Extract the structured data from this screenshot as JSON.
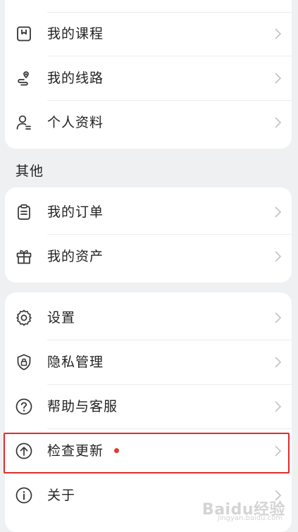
{
  "cards": [
    {
      "items": [
        {
          "label": "我的课程",
          "icon": "bookmark-icon"
        },
        {
          "label": "我的线路",
          "icon": "route-icon"
        },
        {
          "label": "个人资料",
          "icon": "profile-icon"
        }
      ]
    },
    {
      "items": [
        {
          "label": "我的订单",
          "icon": "clipboard-icon"
        },
        {
          "label": "我的资产",
          "icon": "gift-icon"
        }
      ]
    },
    {
      "items": [
        {
          "label": "设置",
          "icon": "gear-icon"
        },
        {
          "label": "隐私管理",
          "icon": "shield-lock-icon"
        },
        {
          "label": "帮助与客服",
          "icon": "help-icon"
        },
        {
          "label": "检查更新",
          "icon": "upload-arrow-icon",
          "badge": "red-dot"
        },
        {
          "label": "关于",
          "icon": "info-icon"
        }
      ]
    }
  ],
  "section_title_other": "其他",
  "highlight_item": "检查更新",
  "colors": {
    "background": "#eff0f2",
    "card": "#ffffff",
    "highlight": "#e02a2a",
    "badge": "#e23b2e",
    "icon": "#333333"
  },
  "watermark": {
    "main": "Baidu经验",
    "sub": "jingyan.baidu.com"
  }
}
